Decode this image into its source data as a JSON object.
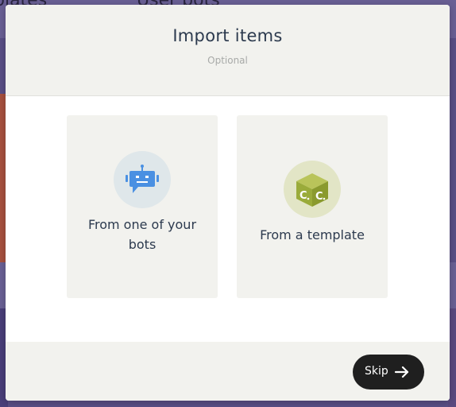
{
  "background": {
    "left_heading": "plates",
    "right_heading": "User bots"
  },
  "modal": {
    "title": "Import items",
    "subtitle": "Optional",
    "options": [
      {
        "label": "From one of your bots",
        "icon": "bot-chat-icon"
      },
      {
        "label": "From a template",
        "icon": "template-cube-icon"
      }
    ],
    "skip_label": "Skip",
    "skip_icon": "arrow-right-icon"
  },
  "colors": {
    "bot_icon": "#4a90e2",
    "template_icon": "#9aab3a",
    "skip_button": "#1f1f1f"
  }
}
